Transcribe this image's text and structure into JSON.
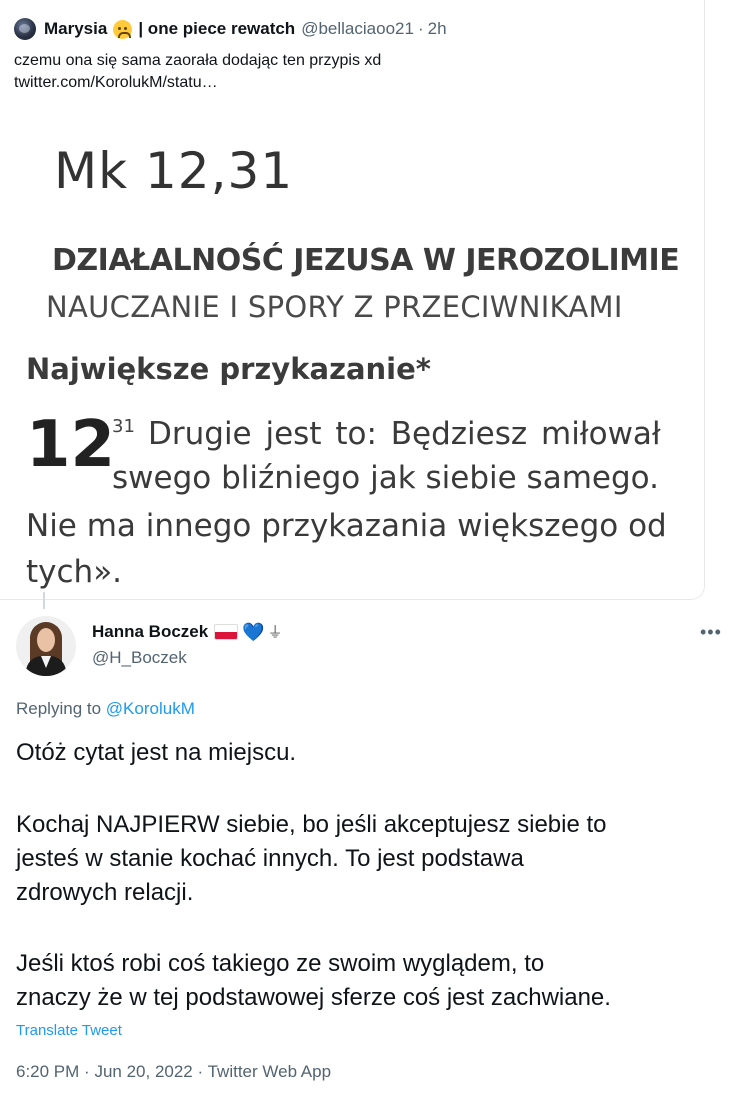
{
  "quoted_tweet": {
    "name": "Marysia",
    "name_suffix": "| one piece rewatch",
    "handle": "@bellaciaoo21",
    "separator": "·",
    "time": "2h",
    "text_line1": "czemu ona się sama zaorała dodając ten przypis xd",
    "text_line2": "twitter.com/KorolukM/statu…",
    "scan": {
      "reference": "Mk 12,31",
      "title": "DZIAŁALNOŚĆ JEZUSA W JEROZOLIMIE",
      "subtitle": "NAUCZANIE I SPORY Z PRZECIWNIKAMI",
      "heading": "Największe przykazanie*",
      "chapter": "12",
      "verse": "31",
      "line1": "Drugie jest to: Będziesz miłował",
      "line2": "swego bliźniego jak siebie samego.",
      "line3": "Nie ma innego przykazania większego od",
      "line4": "tych»."
    }
  },
  "tweet": {
    "name": "Hanna Boczek",
    "heart_glyph": "💙",
    "ground_glyph": "⏚",
    "handle": "@H_Boczek",
    "more_glyph": "•••",
    "replying_prefix": "Replying to",
    "replying_to": "@KorolukM",
    "body_lines": [
      "Otóż cytat jest na miejscu.",
      "Kochaj NAJPIERW siebie, bo jeśli akceptujesz siebie to",
      "jesteś w stanie kochać innych. To jest podstawa",
      "zdrowych relacji.",
      "Jeśli ktoś robi coś takiego ze swoim wyglądem, to",
      "znaczy że w tej podstawowej sferze coś jest zachwiane."
    ],
    "translate_label": "Translate Tweet",
    "time": "6:20 PM",
    "date": "Jun 20, 2022",
    "source": "Twitter Web App",
    "meta_separator": "·"
  },
  "colors": {
    "link": "#1d9bf0",
    "secondary_text": "#536471",
    "primary_text": "#0f1419"
  }
}
